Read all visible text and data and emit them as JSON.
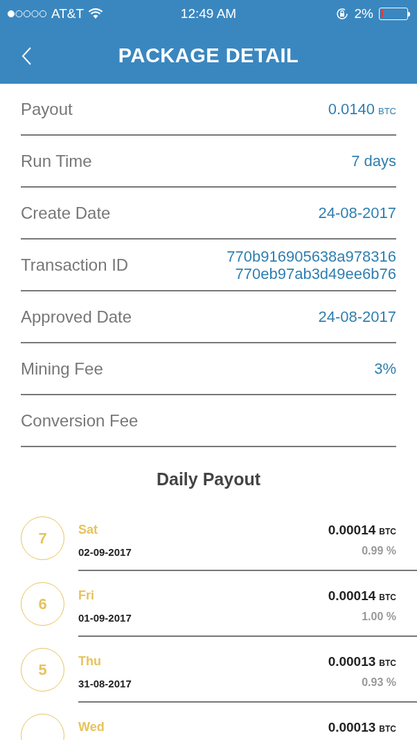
{
  "status_bar": {
    "carrier": "AT&T",
    "time": "12:49 AM",
    "battery": "2%"
  },
  "header": {
    "title": "PACKAGE DETAIL"
  },
  "details": [
    {
      "label": "Payout",
      "value": "0.0140",
      "unit": "BTC"
    },
    {
      "label": "Run Time",
      "value": "7 days"
    },
    {
      "label": "Create Date",
      "value": "24-08-2017"
    },
    {
      "label": "Transaction ID",
      "lines": [
        "770b916905638a978316",
        "770eb97ab3d49ee6b76"
      ]
    },
    {
      "label": "Approved Date",
      "value": "24-08-2017"
    },
    {
      "label": "Mining Fee",
      "value": "3%"
    },
    {
      "label": "Conversion Fee"
    }
  ],
  "daily": {
    "title": "Daily Payout",
    "rows": [
      {
        "day_number": "7",
        "weekday": "Sat",
        "date": "02-09-2017",
        "amount": "0.00014",
        "unit": "BTC",
        "percent": "0.99 %"
      },
      {
        "day_number": "6",
        "weekday": "Fri",
        "date": "01-09-2017",
        "amount": "0.00014",
        "unit": "BTC",
        "percent": "1.00 %"
      },
      {
        "day_number": "5",
        "weekday": "Thu",
        "date": "31-08-2017",
        "amount": "0.00013",
        "unit": "BTC",
        "percent": "0.93 %"
      },
      {
        "weekday": "Wed",
        "amount": "0.00013",
        "unit": "BTC"
      }
    ]
  }
}
